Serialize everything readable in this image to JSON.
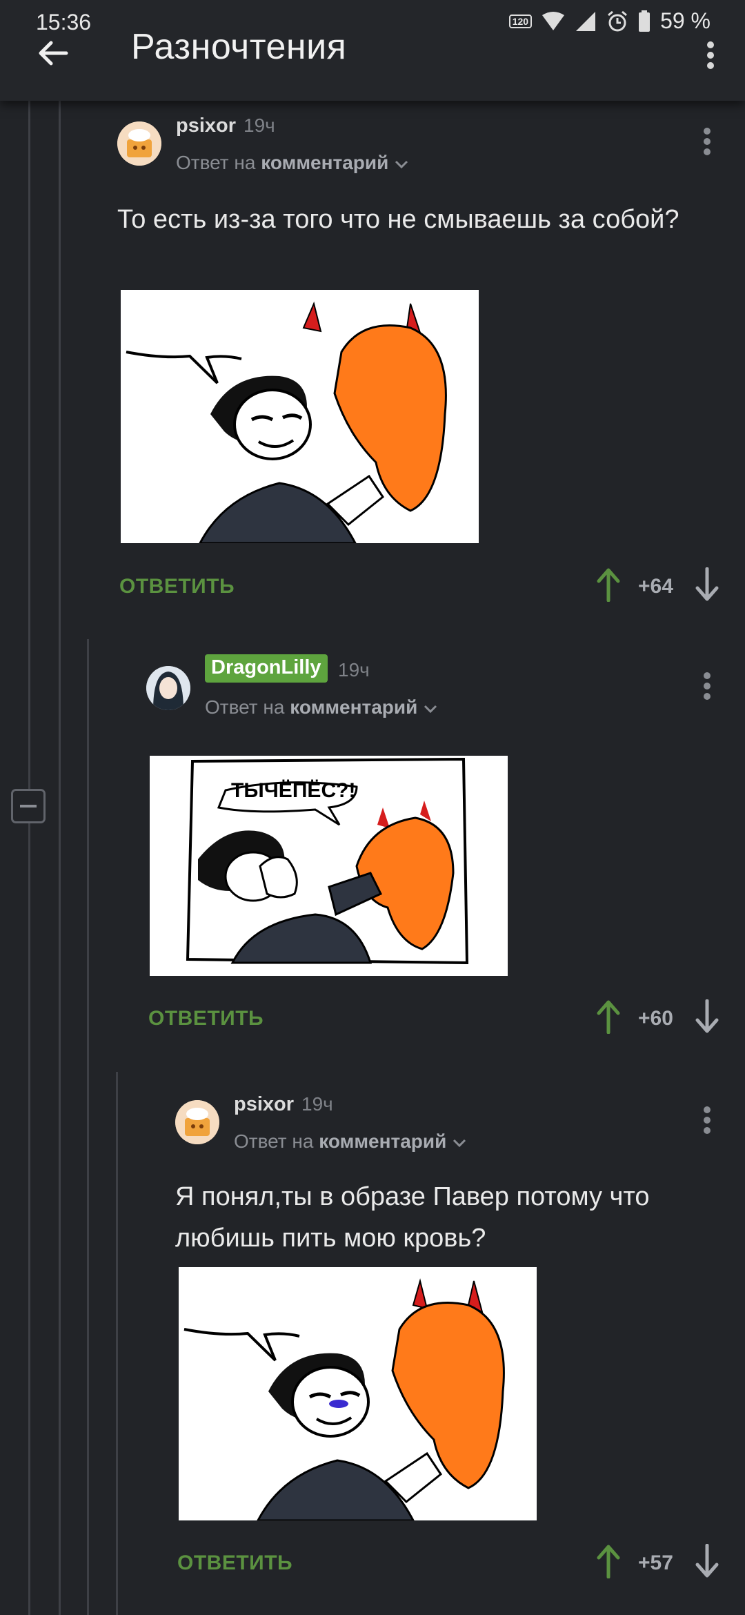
{
  "status": {
    "time": "15:36",
    "hz": "120 Hz",
    "battery": "59 %"
  },
  "header": {
    "title": "Разночтения"
  },
  "comments": [
    {
      "author": "psixor",
      "time": "19ч",
      "reply_prefix": "Ответ на",
      "reply_target": "комментарий",
      "text": "То есть из-за того что не смываешь за собой?",
      "reply_label": "ОТВЕТИТЬ",
      "score": "+64"
    },
    {
      "author": "DragonLilly",
      "time": "19ч",
      "reply_prefix": "Ответ на",
      "reply_target": "комментарий",
      "image_text": "ТЫЧЁПЁС?!",
      "reply_label": "ОТВЕТИТЬ",
      "score": "+60"
    },
    {
      "author": "psixor",
      "time": "19ч",
      "reply_prefix": "Ответ на",
      "reply_target": "комментарий",
      "text": "Я понял,ты в образе Павер потому что любишь пить мою кровь?",
      "reply_label": "ОТВЕТИТЬ",
      "score": "+57"
    }
  ],
  "colors": {
    "background": "#222428",
    "accent_green": "#5b9240",
    "badge_green": "#5ea43e",
    "hair_orange": "#ff7a1a",
    "horn_red": "#d61d1d"
  }
}
